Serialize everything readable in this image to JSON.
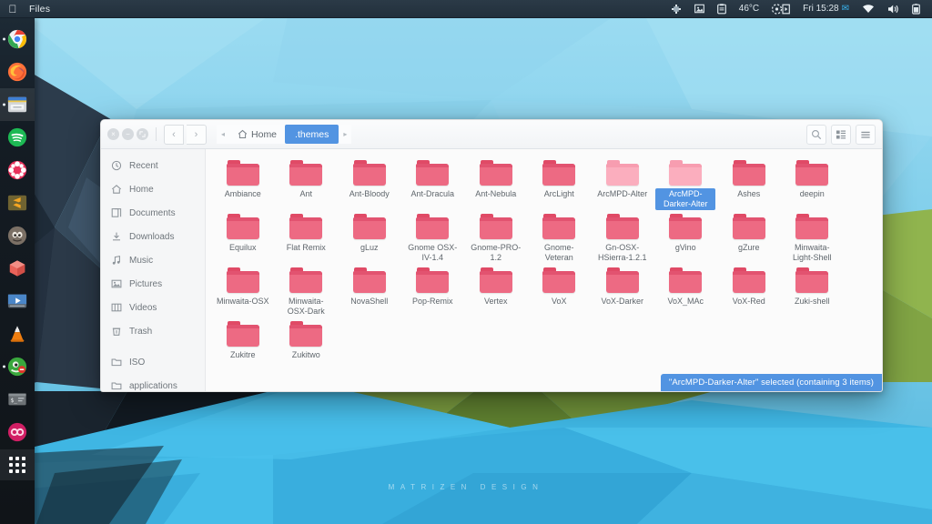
{
  "topbar": {
    "logo_icon": "apple-logo-icon",
    "app_name": "Files",
    "indicators": [
      {
        "name": "system-monitor-icon",
        "label": ""
      },
      {
        "name": "screenshot-icon",
        "label": ""
      },
      {
        "name": "clipboard-icon",
        "label": ""
      },
      {
        "name": "temperature-indicator",
        "label": "46°C"
      },
      {
        "name": "media-player-icon",
        "label": ""
      },
      {
        "name": "clock-indicator",
        "label": "Fri 15:28"
      },
      {
        "name": "mail-icon",
        "label": ""
      },
      {
        "name": "wifi-icon",
        "label": ""
      },
      {
        "name": "volume-icon",
        "label": ""
      },
      {
        "name": "battery-icon",
        "label": ""
      }
    ]
  },
  "dock": {
    "items": [
      {
        "name": "dock-item-chrome",
        "color": "#f5f5f5",
        "running": true
      },
      {
        "name": "dock-item-firefox",
        "color": "#e8622c",
        "running": false
      },
      {
        "name": "dock-item-files",
        "color": "#c9ccce",
        "running": true,
        "active": true
      },
      {
        "name": "dock-item-spotify",
        "color": "#1db954",
        "running": false
      },
      {
        "name": "dock-item-fedora",
        "color": "#e8325c",
        "running": false
      },
      {
        "name": "dock-item-sublime-text",
        "color": "#7a6a2e",
        "running": false
      },
      {
        "name": "dock-item-gimp",
        "color": "#7a6d62",
        "running": false
      },
      {
        "name": "dock-item-virtualbox",
        "color": "#e05a4e",
        "running": false
      },
      {
        "name": "dock-item-video-player",
        "color": "#4a7fb5",
        "running": false
      },
      {
        "name": "dock-item-vlc",
        "color": "#ef7e10",
        "running": false
      },
      {
        "name": "dock-item-steam",
        "color": "#37a83a",
        "running": true
      },
      {
        "name": "dock-item-terminal",
        "color": "#6a6f73",
        "running": false
      },
      {
        "name": "dock-item-oo-app",
        "color": "#d11f64",
        "running": false
      }
    ],
    "app_grid_label": "show-applications"
  },
  "window": {
    "controls": {
      "close": "×",
      "minimize": "−",
      "maximize": "❐"
    },
    "nav": {
      "back": "‹",
      "forward": "›"
    },
    "breadcrumb": {
      "prev_arrow": "◂",
      "next_arrow": "▸",
      "items": [
        {
          "label": "Home",
          "icon": "home-icon",
          "active": false
        },
        {
          "label": ".themes",
          "icon": "",
          "active": true
        }
      ]
    },
    "header_buttons": [
      {
        "name": "search-button",
        "icon": "search-icon"
      },
      {
        "name": "view-options-button",
        "icon": "view-grid-icon"
      },
      {
        "name": "menu-button",
        "icon": "hamburger-menu-icon"
      }
    ],
    "sidebar": {
      "items": [
        {
          "label": "Recent",
          "icon": "clock-icon"
        },
        {
          "label": "Home",
          "icon": "home-icon"
        },
        {
          "label": "Documents",
          "icon": "documents-icon"
        },
        {
          "label": "Downloads",
          "icon": "download-icon"
        },
        {
          "label": "Music",
          "icon": "music-note-icon"
        },
        {
          "label": "Pictures",
          "icon": "picture-icon"
        },
        {
          "label": "Videos",
          "icon": "video-icon"
        },
        {
          "label": "Trash",
          "icon": "trash-icon"
        }
      ],
      "items2": [
        {
          "label": "ISO",
          "icon": "folder-icon"
        },
        {
          "label": "applications",
          "icon": "folder-icon"
        }
      ]
    },
    "folders": [
      {
        "label": "Ambiance",
        "light": false,
        "selected": false
      },
      {
        "label": "Ant",
        "light": false,
        "selected": false
      },
      {
        "label": "Ant-Bloody",
        "light": false,
        "selected": false
      },
      {
        "label": "Ant-Dracula",
        "light": false,
        "selected": false
      },
      {
        "label": "Ant-Nebula",
        "light": false,
        "selected": false
      },
      {
        "label": "ArcLight",
        "light": false,
        "selected": false
      },
      {
        "label": "ArcMPD-Alter",
        "light": true,
        "selected": false
      },
      {
        "label": "ArcMPD-Darker-Alter",
        "light": true,
        "selected": true
      },
      {
        "label": "Ashes",
        "light": false,
        "selected": false
      },
      {
        "label": "deepin",
        "light": false,
        "selected": false
      },
      {
        "label": "Equilux",
        "light": false,
        "selected": false
      },
      {
        "label": "Flat Remix",
        "light": false,
        "selected": false
      },
      {
        "label": "gLuz",
        "light": false,
        "selected": false
      },
      {
        "label": "Gnome OSX-IV-1.4",
        "light": false,
        "selected": false
      },
      {
        "label": "Gnome-PRO-1.2",
        "light": false,
        "selected": false
      },
      {
        "label": "Gnome-Veteran",
        "light": false,
        "selected": false
      },
      {
        "label": "Gn-OSX-HSierra-1.2.1",
        "light": false,
        "selected": false
      },
      {
        "label": "gVino",
        "light": false,
        "selected": false
      },
      {
        "label": "gZure",
        "light": false,
        "selected": false
      },
      {
        "label": "Minwaita-Light-Shell",
        "light": false,
        "selected": false
      },
      {
        "label": "Minwaita-OSX",
        "light": false,
        "selected": false
      },
      {
        "label": "Minwaita-OSX-Dark",
        "light": false,
        "selected": false
      },
      {
        "label": "NovaShell",
        "light": false,
        "selected": false
      },
      {
        "label": "Pop-Remix",
        "light": false,
        "selected": false
      },
      {
        "label": "Vertex",
        "light": false,
        "selected": false
      },
      {
        "label": "VoX",
        "light": false,
        "selected": false
      },
      {
        "label": "VoX-Darker",
        "light": false,
        "selected": false
      },
      {
        "label": "VoX_MAc",
        "light": false,
        "selected": false
      },
      {
        "label": "VoX-Red",
        "light": false,
        "selected": false
      },
      {
        "label": "Zuki-shell",
        "light": false,
        "selected": false
      },
      {
        "label": "Zukitre",
        "light": false,
        "selected": false
      },
      {
        "label": "Zukitwo",
        "light": false,
        "selected": false
      }
    ],
    "statusbar": "\"ArcMPD-Darker-Alter\" selected  (containing 3 items)"
  },
  "desktop": {
    "watermark": "MATRIZEN DESIGN"
  },
  "colors": {
    "accent": "#5294e2",
    "folder": "#ed6a83",
    "folder_light": "#fbaebe",
    "topbar": "#22303c"
  }
}
